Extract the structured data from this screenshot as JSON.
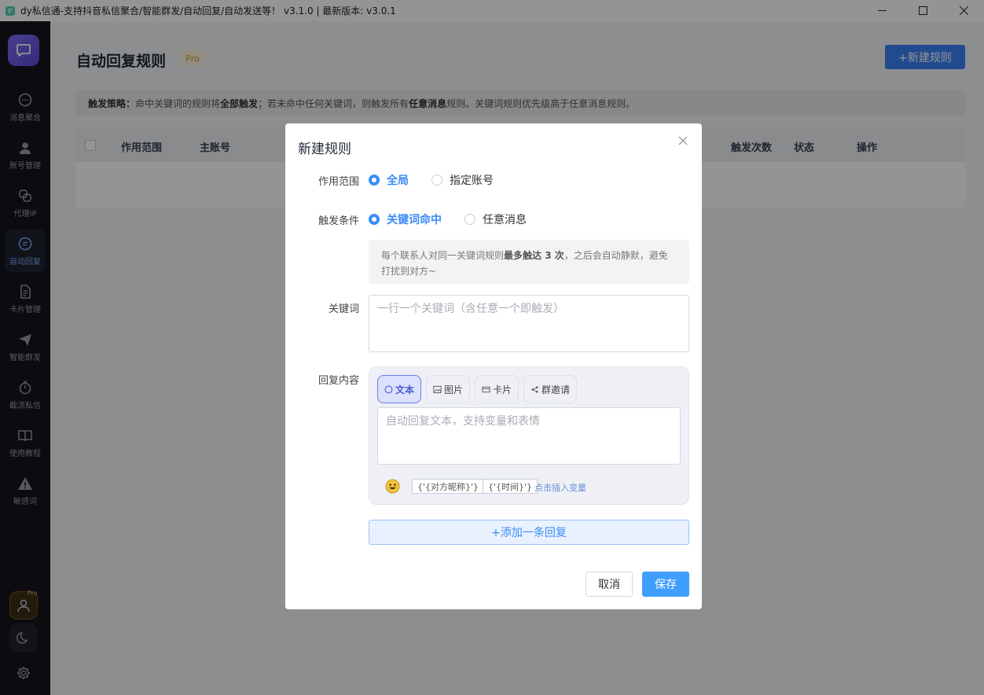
{
  "window": {
    "title": "dy私信通-支持抖音私信聚合/智能群发/自动回复/自动发送等！ v3.1.0 | 最新版本: v3.0.1"
  },
  "sidebar": {
    "items": [
      {
        "label": "消息聚合",
        "icon": "chat-bubble-icon"
      },
      {
        "label": "账号管理",
        "icon": "user-icon"
      },
      {
        "label": "代理IP",
        "icon": "link-icon"
      },
      {
        "label": "自动回复",
        "icon": "auto-reply-icon"
      },
      {
        "label": "卡片管理",
        "icon": "document-icon"
      },
      {
        "label": "智能群发",
        "icon": "send-icon"
      },
      {
        "label": "截流私信",
        "icon": "stopwatch-icon"
      },
      {
        "label": "使用教程",
        "icon": "book-icon"
      },
      {
        "label": "敏感词",
        "icon": "warning-icon"
      }
    ],
    "avatar_badge": "Pro"
  },
  "page": {
    "title": "自动回复规则",
    "pro_badge": "Pro",
    "new_rule_button": "+新建规则",
    "strategy": {
      "label": "触发策略：",
      "t1": "命中关键词的规则将",
      "b1": "全部触发",
      "t2": "；若未命中任何关键词，则触发所有",
      "b2": "任意消息",
      "t3": "规则。关键词规则优先级高于任意消息规则。"
    },
    "table_headers": [
      "作用范围",
      "主账号",
      "触发次数",
      "状态",
      "操作"
    ]
  },
  "modal": {
    "title": "新建规则",
    "scope": {
      "label": "作用范围",
      "options": [
        "全局",
        "指定账号"
      ],
      "selected": "全局"
    },
    "trigger": {
      "label": "触发条件",
      "options": [
        "关键词命中",
        "任意消息"
      ],
      "selected": "关键词命中"
    },
    "tip": {
      "t1": "每个联系人对同一关键词规则",
      "b1": "最多触达 3 次",
      "t2": "，之后会自动静默，避免打扰到对方~"
    },
    "keyword": {
      "label": "关键词",
      "placeholder": "一行一个关键词（含任意一个即触发）"
    },
    "reply": {
      "label": "回复内容",
      "tabs": [
        "文本",
        "图片",
        "卡片",
        "群邀请"
      ],
      "active_tab": "文本",
      "placeholder": "自动回复文本，支持变量和表情",
      "variables": [
        "{'{对方昵称}'}",
        "{'{时间}'}"
      ],
      "variable_hint": "点击插入变量"
    },
    "add_reply_button": "+添加一条回复",
    "cancel_button": "取消",
    "save_button": "保存"
  },
  "colors": {
    "accent": "#409eff",
    "sidebar_bg": "#15151c",
    "primary_button": "#3b82f6"
  }
}
